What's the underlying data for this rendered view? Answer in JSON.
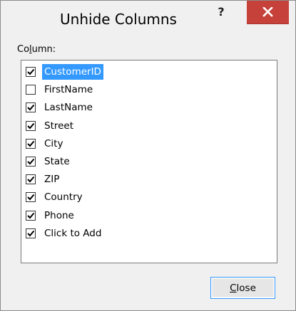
{
  "dialog": {
    "title": "Unhide Columns",
    "help_label": "?",
    "close_icon": "close-x-icon"
  },
  "list": {
    "label_prefix": "Co",
    "label_accel": "l",
    "label_suffix": "umn:",
    "items": [
      {
        "label": "CustomerID",
        "checked": true,
        "selected": true
      },
      {
        "label": "FirstName",
        "checked": false,
        "selected": false
      },
      {
        "label": "LastName",
        "checked": true,
        "selected": false
      },
      {
        "label": "Street",
        "checked": true,
        "selected": false
      },
      {
        "label": "City",
        "checked": true,
        "selected": false
      },
      {
        "label": "State",
        "checked": true,
        "selected": false
      },
      {
        "label": "ZIP",
        "checked": true,
        "selected": false
      },
      {
        "label": "Country",
        "checked": true,
        "selected": false
      },
      {
        "label": "Phone",
        "checked": true,
        "selected": false
      },
      {
        "label": "Click to Add",
        "checked": true,
        "selected": false
      }
    ]
  },
  "buttons": {
    "close_accel": "C",
    "close_rest": "lose"
  },
  "colors": {
    "selection": "#3399ff",
    "close_x_bg": "#c7413b",
    "button_focus_border": "#3399ff"
  }
}
